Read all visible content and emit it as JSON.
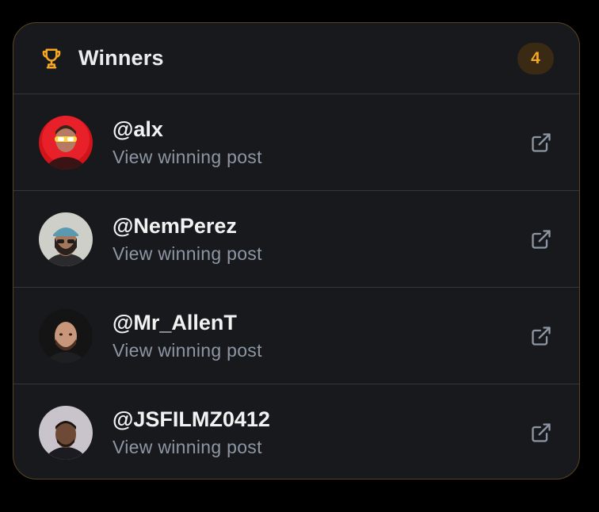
{
  "header": {
    "title": "Winners",
    "count": "4",
    "icon": "trophy-icon",
    "accent_color": "#f5a623"
  },
  "winners": [
    {
      "handle": "@alx",
      "subtitle": "View winning post",
      "link_icon": "external-link-icon"
    },
    {
      "handle": "@NemPerez",
      "subtitle": "View winning post",
      "link_icon": "external-link-icon"
    },
    {
      "handle": "@Mr_AllenT",
      "subtitle": "View winning post",
      "link_icon": "external-link-icon"
    },
    {
      "handle": "@JSFILMZ0412",
      "subtitle": "View winning post",
      "link_icon": "external-link-icon"
    }
  ]
}
